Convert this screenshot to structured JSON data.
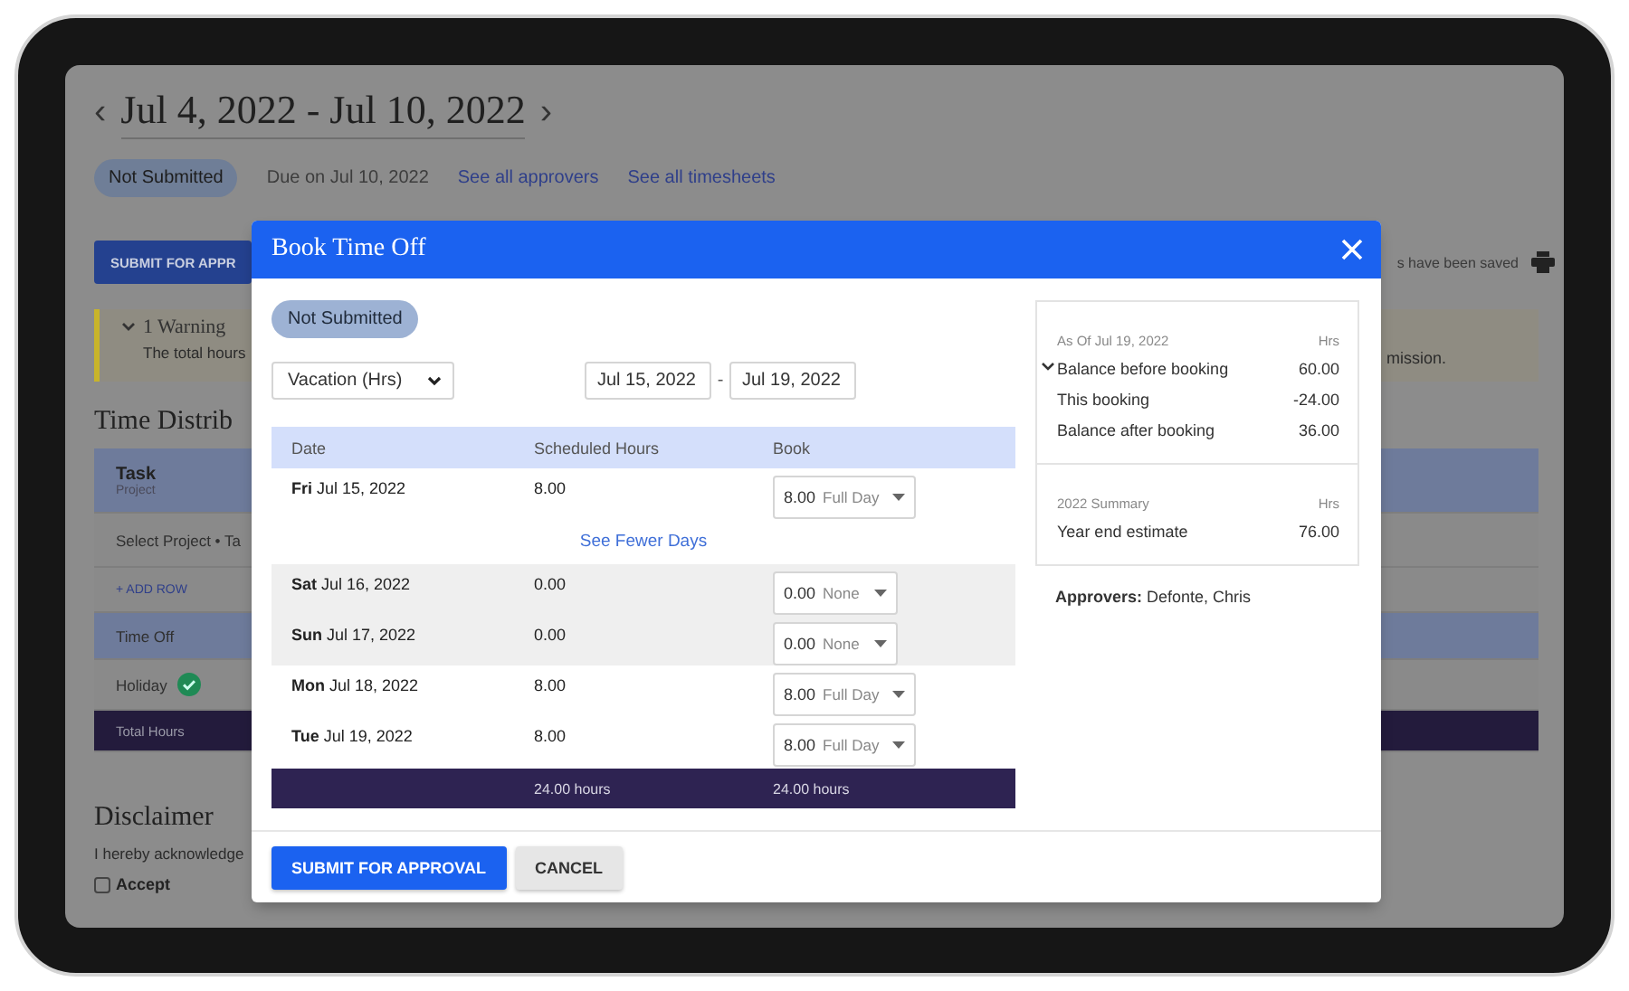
{
  "background": {
    "nav_prev": "‹",
    "title": "Jul 4, 2022 - Jul 10, 2022",
    "nav_next": "›",
    "status": "Not Submitted",
    "due": "Due on Jul 10, 2022",
    "links": [
      "See all approvers",
      "See all timesheets"
    ],
    "submit_button": "SUBMIT FOR APPR",
    "saved_note": "s have been saved",
    "warning": {
      "title": "1 Warning",
      "text": "The total hours",
      "text_tail": "mission."
    },
    "section_title": "Time Distrib",
    "table_rows": [
      {
        "kind": "header",
        "label": "Task",
        "sublabel": "Project"
      },
      {
        "kind": "input",
        "label": "Select Project • Ta"
      },
      {
        "kind": "add",
        "label": "+ ADD ROW"
      },
      {
        "kind": "group",
        "label": "Time Off"
      },
      {
        "kind": "holiday",
        "label": "Holiday"
      },
      {
        "kind": "total",
        "label": "Total Hours"
      }
    ],
    "disclaimer": {
      "title": "Disclaimer",
      "text": "I hereby acknowledge",
      "accept": {
        "label": "Accept",
        "checked": false
      }
    }
  },
  "dialog": {
    "title": "Book Time Off",
    "status": "Not Submitted",
    "leave_type": "Vacation (Hrs)",
    "start_date": "Jul 15, 2022",
    "separator": "-",
    "end_date": "Jul 19, 2022",
    "columns": [
      "Date",
      "Scheduled Hours",
      "Book"
    ],
    "rows": [
      {
        "kind": "day",
        "date": "**Fri**  Jul 15, 2022",
        "scheduled": "8.00",
        "book": "8.00",
        "book_option": "Full Day",
        "weekend": false
      },
      {
        "kind": "link",
        "label": "See Fewer Days"
      },
      {
        "kind": "day",
        "date": "**Sat** Jul 16, 2022",
        "scheduled": "0.00",
        "book": "0.00",
        "book_option": "None",
        "weekend": true
      },
      {
        "kind": "day",
        "date": "**Sun** Jul 17, 2022",
        "scheduled": "0.00",
        "book": "0.00",
        "book_option": "None",
        "weekend": true
      },
      {
        "kind": "day",
        "date": "**Mon** Jul 18, 2022",
        "scheduled": "8.00",
        "book": "8.00",
        "book_option": "Full Day",
        "weekend": false
      },
      {
        "kind": "day",
        "date": "**Tue** Jul 19, 2022",
        "scheduled": "8.00",
        "book": "8.00",
        "book_option": "Full Day",
        "weekend": false
      }
    ],
    "totals": [
      "24.00 hours",
      "24.00 hours"
    ],
    "balance": {
      "as_of": "As Of Jul 19, 2022",
      "unit": "Hrs",
      "rows": [
        {
          "kind": "toggle",
          "label": "Balance before booking",
          "value": "60.00"
        },
        {
          "kind": "plain",
          "label": "This booking",
          "value": "-24.00"
        },
        {
          "kind": "plain",
          "label": "Balance after booking",
          "value": "36.00"
        }
      ],
      "summary_title": "2022 Summary",
      "summary_unit": "Hrs",
      "summary_rows": [
        {
          "kind": "plain",
          "label": "Year end estimate",
          "value": "76.00"
        }
      ]
    },
    "approvers": "**Approvers:** Defonte, Chris",
    "buttons": [
      {
        "kind": "primary",
        "label": "SUBMIT FOR APPROVAL"
      },
      {
        "kind": "secondary",
        "label": "CANCEL"
      }
    ]
  }
}
